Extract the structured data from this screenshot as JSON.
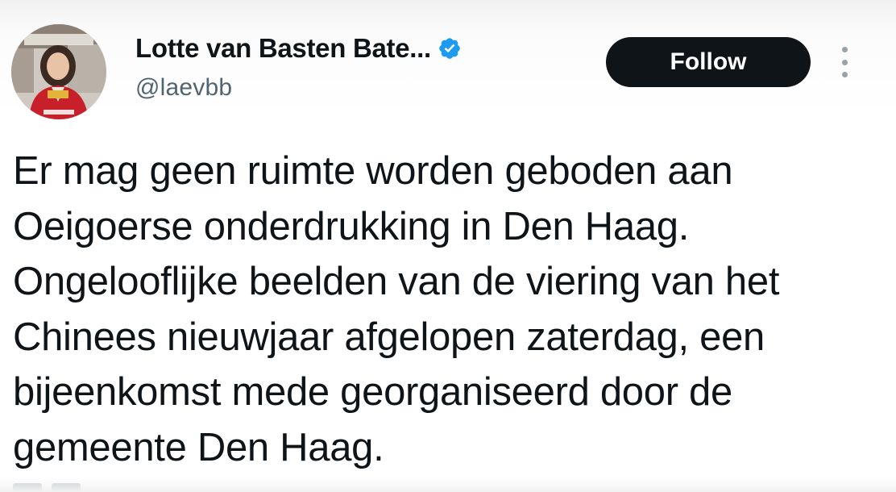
{
  "profile": {
    "display_name": "Lotte van Basten Bate...",
    "handle": "@laevbb",
    "verified": true,
    "avatar": "profile-photo"
  },
  "actions": {
    "follow_label": "Follow",
    "more_icon": "vertical-ellipsis-icon"
  },
  "tweet": {
    "lines": [
      "Er mag geen ruimte worden geboden aan",
      "Oeigoerse onderdrukking in Den Haag.",
      "Ongelooflijke beelden van de viering van het",
      "Chinees nieuwjaar afgelopen zaterdag, een",
      "bijeenkomst mede georganiseerd door de",
      "gemeente Den Haag."
    ]
  },
  "colors": {
    "text": "#0f1419",
    "secondary": "#536471",
    "follow_bg": "#0f1419",
    "verified": "#1d9bf0"
  }
}
